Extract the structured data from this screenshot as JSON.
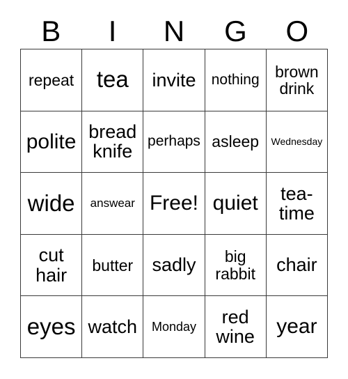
{
  "card": {
    "title_letters": [
      "B",
      "I",
      "N",
      "G",
      "O"
    ],
    "columns": 5,
    "rows": 5,
    "free_space_label": "Free!",
    "free_space_position": {
      "row": 3,
      "column": 3
    },
    "colors": {
      "background": "#ffffff",
      "text": "#000000",
      "grid_line": "#3a3a3a"
    },
    "cells": [
      [
        {
          "text": "repeat",
          "size": "md",
          "lines": 1
        },
        {
          "text": "tea",
          "size": "xxl",
          "lines": 1
        },
        {
          "text": "invite",
          "size": "lg",
          "lines": 1
        },
        {
          "text": "nothing",
          "size": "sm",
          "lines": 1
        },
        {
          "text": "brown\ndrink",
          "size": "md",
          "lines": 2
        }
      ],
      [
        {
          "text": "polite",
          "size": "xl",
          "lines": 1
        },
        {
          "text": "bread\nknife",
          "size": "lg",
          "lines": 2
        },
        {
          "text": "perhaps",
          "size": "sm",
          "lines": 1
        },
        {
          "text": "asleep",
          "size": "md",
          "lines": 1
        },
        {
          "text": "Wednesday",
          "size": "tiny",
          "lines": 1
        }
      ],
      [
        {
          "text": "wide",
          "size": "xxl",
          "lines": 1
        },
        {
          "text": "answear",
          "size": "xxs",
          "lines": 1
        },
        {
          "text": "Free!",
          "size": "xl",
          "lines": 1
        },
        {
          "text": "quiet",
          "size": "xl",
          "lines": 1
        },
        {
          "text": "tea-\ntime",
          "size": "lg",
          "lines": 2
        }
      ],
      [
        {
          "text": "cut\nhair",
          "size": "lg",
          "lines": 2
        },
        {
          "text": "butter",
          "size": "md",
          "lines": 1
        },
        {
          "text": "sadly",
          "size": "lg",
          "lines": 1
        },
        {
          "text": "big\nrabbit",
          "size": "md",
          "lines": 2
        },
        {
          "text": "chair",
          "size": "lg",
          "lines": 1
        }
      ],
      [
        {
          "text": "eyes",
          "size": "xxl",
          "lines": 1
        },
        {
          "text": "watch",
          "size": "lg",
          "lines": 1
        },
        {
          "text": "Monday",
          "size": "xs",
          "lines": 1
        },
        {
          "text": "red\nwine",
          "size": "lg",
          "lines": 2
        },
        {
          "text": "year",
          "size": "xl",
          "lines": 1
        }
      ]
    ]
  }
}
